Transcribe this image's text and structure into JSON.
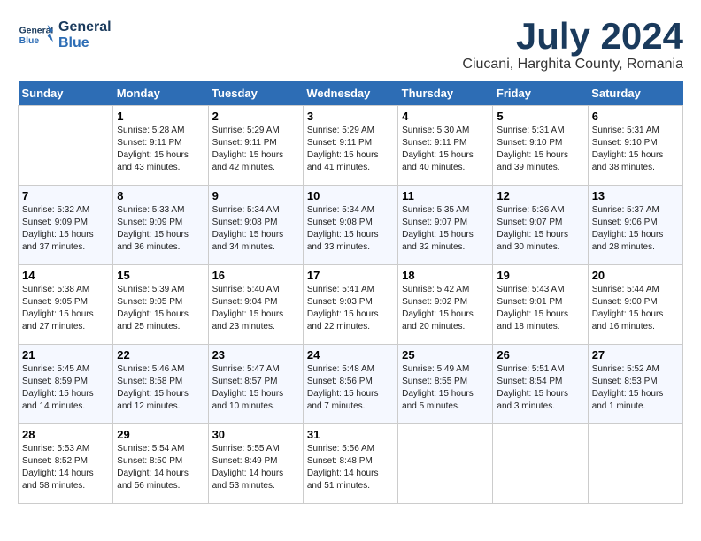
{
  "header": {
    "logo_line1": "General",
    "logo_line2": "Blue",
    "month": "July 2024",
    "location": "Ciucani, Harghita County, Romania"
  },
  "weekdays": [
    "Sunday",
    "Monday",
    "Tuesday",
    "Wednesday",
    "Thursday",
    "Friday",
    "Saturday"
  ],
  "weeks": [
    [
      null,
      {
        "day": 1,
        "sunrise": "5:28 AM",
        "sunset": "9:11 PM",
        "daylight": "15 hours and 43 minutes."
      },
      {
        "day": 2,
        "sunrise": "5:29 AM",
        "sunset": "9:11 PM",
        "daylight": "15 hours and 42 minutes."
      },
      {
        "day": 3,
        "sunrise": "5:29 AM",
        "sunset": "9:11 PM",
        "daylight": "15 hours and 41 minutes."
      },
      {
        "day": 4,
        "sunrise": "5:30 AM",
        "sunset": "9:11 PM",
        "daylight": "15 hours and 40 minutes."
      },
      {
        "day": 5,
        "sunrise": "5:31 AM",
        "sunset": "9:10 PM",
        "daylight": "15 hours and 39 minutes."
      },
      {
        "day": 6,
        "sunrise": "5:31 AM",
        "sunset": "9:10 PM",
        "daylight": "15 hours and 38 minutes."
      }
    ],
    [
      {
        "day": 7,
        "sunrise": "5:32 AM",
        "sunset": "9:09 PM",
        "daylight": "15 hours and 37 minutes."
      },
      {
        "day": 8,
        "sunrise": "5:33 AM",
        "sunset": "9:09 PM",
        "daylight": "15 hours and 36 minutes."
      },
      {
        "day": 9,
        "sunrise": "5:34 AM",
        "sunset": "9:08 PM",
        "daylight": "15 hours and 34 minutes."
      },
      {
        "day": 10,
        "sunrise": "5:34 AM",
        "sunset": "9:08 PM",
        "daylight": "15 hours and 33 minutes."
      },
      {
        "day": 11,
        "sunrise": "5:35 AM",
        "sunset": "9:07 PM",
        "daylight": "15 hours and 32 minutes."
      },
      {
        "day": 12,
        "sunrise": "5:36 AM",
        "sunset": "9:07 PM",
        "daylight": "15 hours and 30 minutes."
      },
      {
        "day": 13,
        "sunrise": "5:37 AM",
        "sunset": "9:06 PM",
        "daylight": "15 hours and 28 minutes."
      }
    ],
    [
      {
        "day": 14,
        "sunrise": "5:38 AM",
        "sunset": "9:05 PM",
        "daylight": "15 hours and 27 minutes."
      },
      {
        "day": 15,
        "sunrise": "5:39 AM",
        "sunset": "9:05 PM",
        "daylight": "15 hours and 25 minutes."
      },
      {
        "day": 16,
        "sunrise": "5:40 AM",
        "sunset": "9:04 PM",
        "daylight": "15 hours and 23 minutes."
      },
      {
        "day": 17,
        "sunrise": "5:41 AM",
        "sunset": "9:03 PM",
        "daylight": "15 hours and 22 minutes."
      },
      {
        "day": 18,
        "sunrise": "5:42 AM",
        "sunset": "9:02 PM",
        "daylight": "15 hours and 20 minutes."
      },
      {
        "day": 19,
        "sunrise": "5:43 AM",
        "sunset": "9:01 PM",
        "daylight": "15 hours and 18 minutes."
      },
      {
        "day": 20,
        "sunrise": "5:44 AM",
        "sunset": "9:00 PM",
        "daylight": "15 hours and 16 minutes."
      }
    ],
    [
      {
        "day": 21,
        "sunrise": "5:45 AM",
        "sunset": "8:59 PM",
        "daylight": "15 hours and 14 minutes."
      },
      {
        "day": 22,
        "sunrise": "5:46 AM",
        "sunset": "8:58 PM",
        "daylight": "15 hours and 12 minutes."
      },
      {
        "day": 23,
        "sunrise": "5:47 AM",
        "sunset": "8:57 PM",
        "daylight": "15 hours and 10 minutes."
      },
      {
        "day": 24,
        "sunrise": "5:48 AM",
        "sunset": "8:56 PM",
        "daylight": "15 hours and 7 minutes."
      },
      {
        "day": 25,
        "sunrise": "5:49 AM",
        "sunset": "8:55 PM",
        "daylight": "15 hours and 5 minutes."
      },
      {
        "day": 26,
        "sunrise": "5:51 AM",
        "sunset": "8:54 PM",
        "daylight": "15 hours and 3 minutes."
      },
      {
        "day": 27,
        "sunrise": "5:52 AM",
        "sunset": "8:53 PM",
        "daylight": "15 hours and 1 minute."
      }
    ],
    [
      {
        "day": 28,
        "sunrise": "5:53 AM",
        "sunset": "8:52 PM",
        "daylight": "14 hours and 58 minutes."
      },
      {
        "day": 29,
        "sunrise": "5:54 AM",
        "sunset": "8:50 PM",
        "daylight": "14 hours and 56 minutes."
      },
      {
        "day": 30,
        "sunrise": "5:55 AM",
        "sunset": "8:49 PM",
        "daylight": "14 hours and 53 minutes."
      },
      {
        "day": 31,
        "sunrise": "5:56 AM",
        "sunset": "8:48 PM",
        "daylight": "14 hours and 51 minutes."
      },
      null,
      null,
      null
    ]
  ]
}
